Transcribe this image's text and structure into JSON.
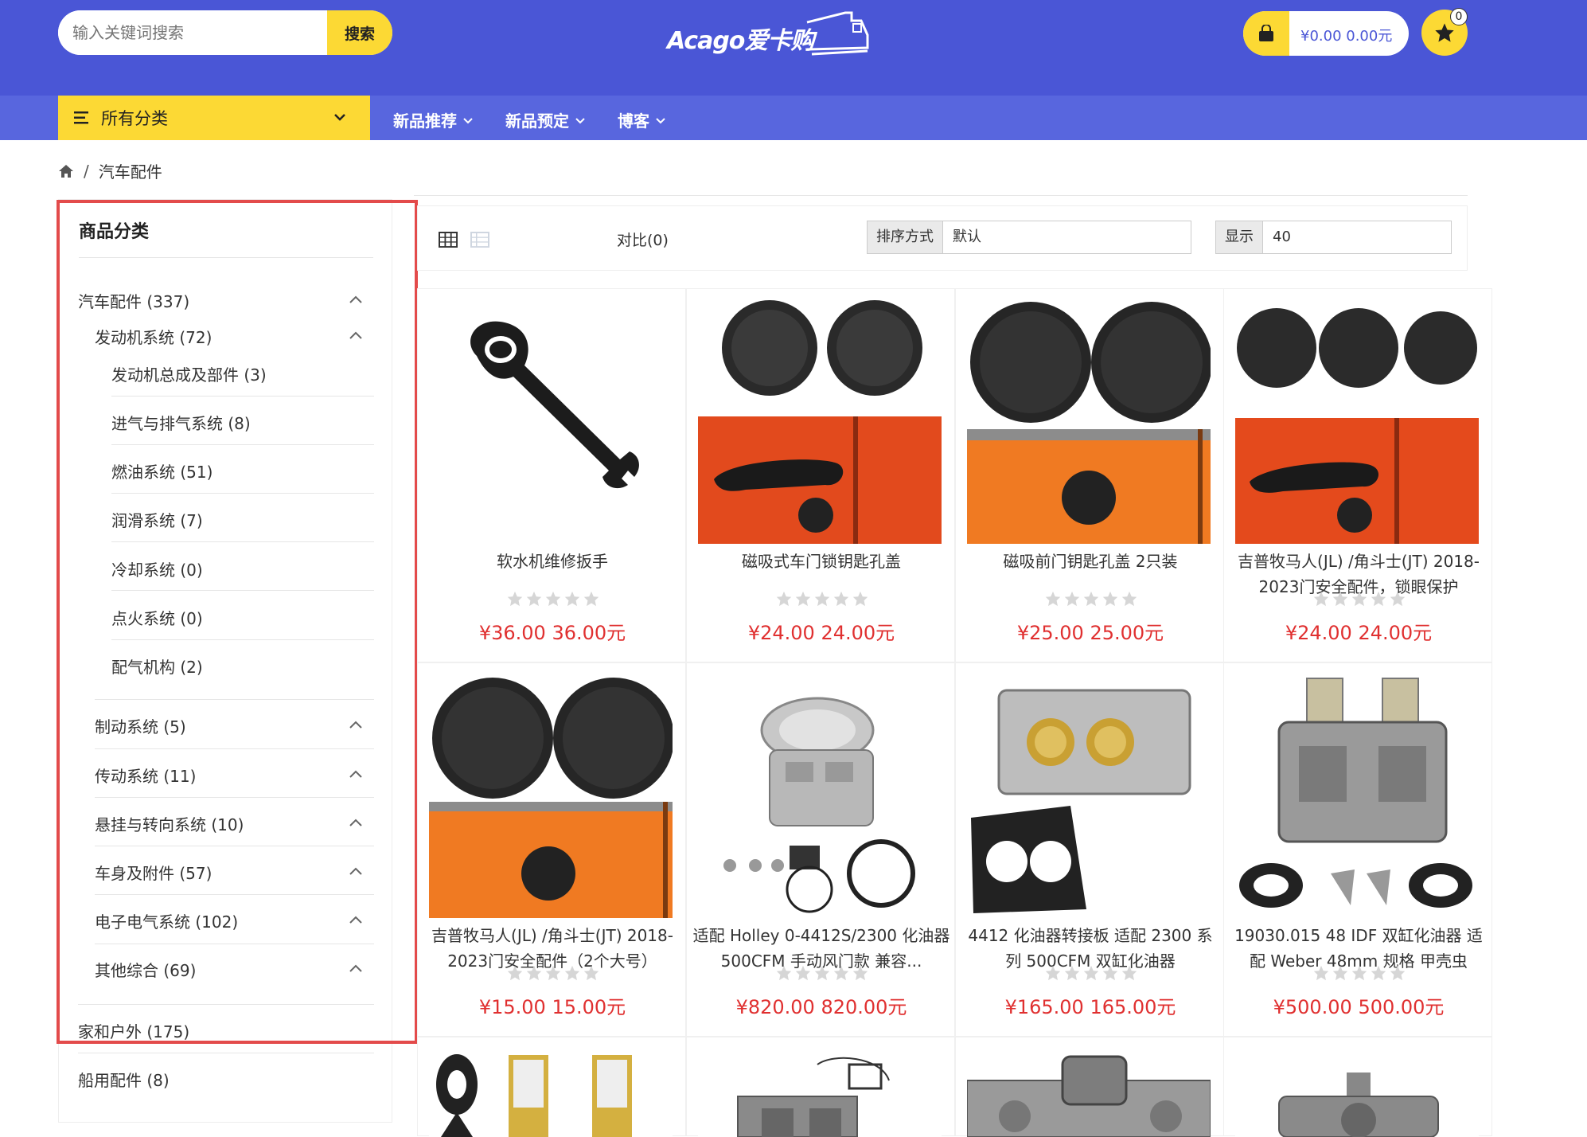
{
  "header": {
    "search_placeholder": "输入关键词搜索",
    "search_button": "搜索",
    "logo_text": "Acago爱卡购",
    "cart_text": "¥0.00  0.00元",
    "fav_count": "0"
  },
  "nav": {
    "all_categories": "所有分类",
    "items": [
      "新品推荐",
      "新品预定",
      "博客"
    ]
  },
  "breadcrumb": {
    "current": "汽车配件"
  },
  "sidebar": {
    "title": "商品分类",
    "top": [
      {
        "label": "汽车配件 (337)"
      },
      {
        "label": "家和户外 (175)"
      },
      {
        "label": "船用配件 (8)"
      }
    ],
    "sub": [
      {
        "label": "发动机系统 (72)"
      },
      {
        "label": "制动系统 (5)"
      },
      {
        "label": "传动系统 (11)"
      },
      {
        "label": "悬挂与转向系统 (10)"
      },
      {
        "label": "车身及附件 (57)"
      },
      {
        "label": "电子电气系统 (102)"
      },
      {
        "label": "其他综合 (69)"
      }
    ],
    "subsub": [
      {
        "label": "发动机总成及部件 (3)"
      },
      {
        "label": "进气与排气系统 (8)"
      },
      {
        "label": "燃油系统 (51)"
      },
      {
        "label": "润滑系统 (7)"
      },
      {
        "label": "冷却系统 (0)"
      },
      {
        "label": "点火系统 (0)"
      },
      {
        "label": "配气机构 (2)"
      }
    ]
  },
  "toolbar": {
    "compare": "对比(0)",
    "sort_label": "排序方式",
    "sort_value": "默认",
    "show_label": "显示",
    "show_value": "40"
  },
  "products": [
    {
      "name": "软水机维修扳手",
      "price": "¥36.00  36.00元",
      "rating": 0
    },
    {
      "name": "磁吸式车门锁钥匙孔盖",
      "price": "¥24.00  24.00元",
      "rating": 0
    },
    {
      "name": "磁吸前门钥匙孔盖 2只装",
      "price": "¥25.00  25.00元",
      "rating": 0
    },
    {
      "name": "吉普牧马人(JL) /角斗士(JT) 2018-2023门安全配件，锁眼保护",
      "price": "¥24.00  24.00元",
      "rating": 0
    },
    {
      "name": "吉普牧马人(JL) /角斗士(JT) 2018-2023门安全配件（2个大号）",
      "price": "¥15.00  15.00元",
      "rating": 0
    },
    {
      "name": "适配 Holley 0-4412S/2300 化油器 500CFM 手动风门款 兼容...",
      "price": "¥820.00  820.00元",
      "rating": 0
    },
    {
      "name": "4412 化油器转接板 适配 2300 系列 500CFM 双缸化油器",
      "price": "¥165.00  165.00元",
      "rating": 0
    },
    {
      "name": "19030.015 48 IDF 双缸化油器 适配 Weber 48mm 规格 甲壳虫",
      "price": "¥500.00  500.00元",
      "rating": 0
    }
  ],
  "colors": {
    "header_bg": "#4a56d6",
    "nav_bg": "#5866de",
    "accent_yellow": "#fcd934",
    "price_red": "#e03030",
    "highlight_red": "#e34b4b"
  }
}
